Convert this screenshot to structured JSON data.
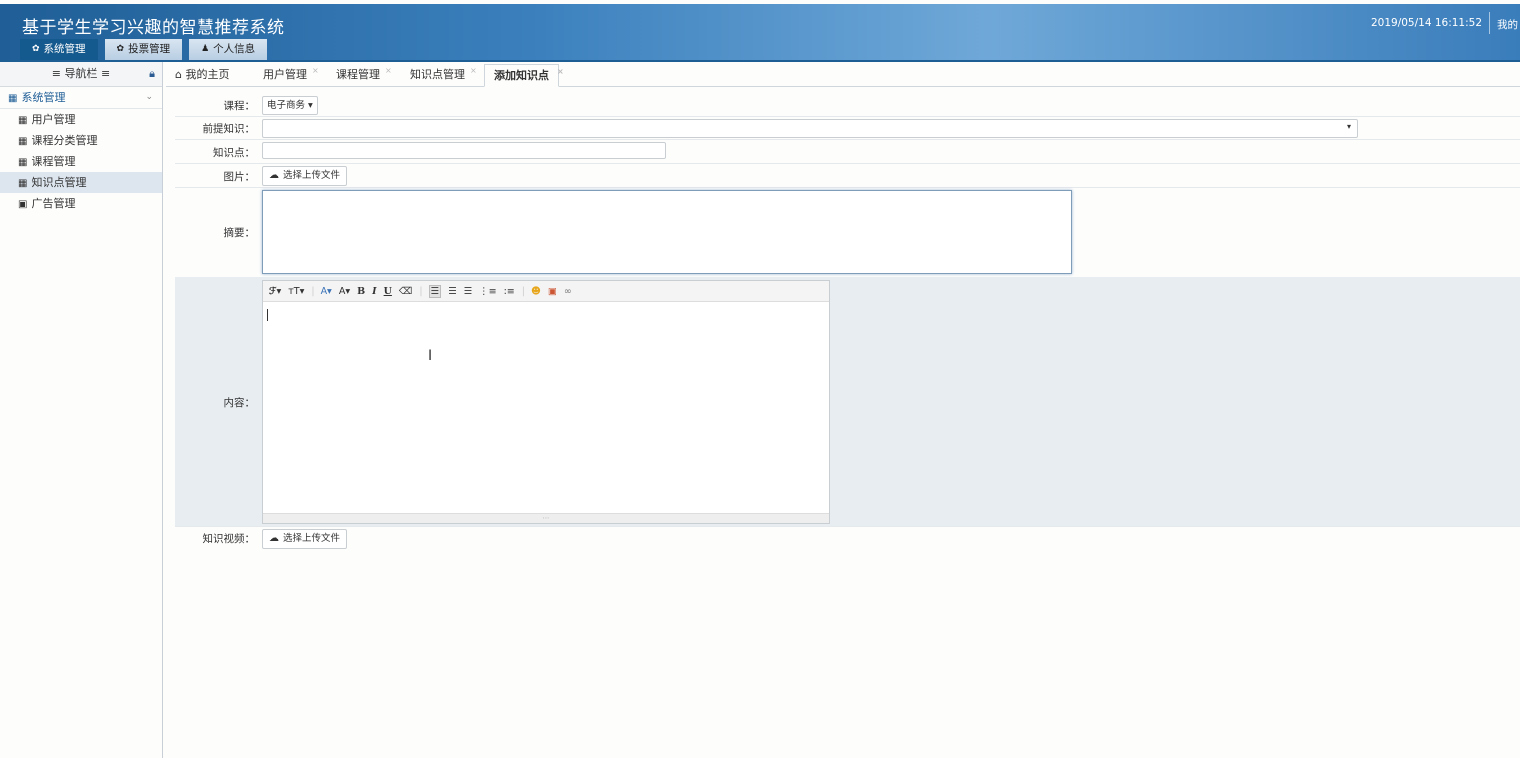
{
  "header": {
    "app_title": "基于学生学习兴趣的智慧推荐系统",
    "datetime": "2019/05/14 16:11:52",
    "user_link": "我的",
    "nav": [
      {
        "label": "系统管理",
        "icon": "gear-icon"
      },
      {
        "label": "投票管理",
        "icon": "gear-icon"
      },
      {
        "label": "个人信息",
        "icon": "user-icon"
      }
    ]
  },
  "sidebar": {
    "title": "≡ 导航栏 ≡",
    "group_label": "系统管理",
    "items": [
      {
        "label": "用户管理",
        "icon": "table-icon"
      },
      {
        "label": "课程分类管理",
        "icon": "table-icon"
      },
      {
        "label": "课程管理",
        "icon": "table-icon"
      },
      {
        "label": "知识点管理",
        "icon": "table-icon"
      },
      {
        "label": "广告管理",
        "icon": "picture-icon"
      }
    ]
  },
  "tabs": [
    {
      "label": "我的主页",
      "icon": "home-icon"
    },
    {
      "label": "用户管理"
    },
    {
      "label": "课程管理"
    },
    {
      "label": "知识点管理"
    },
    {
      "label": "添加知识点"
    }
  ],
  "form": {
    "course_label": "课程：",
    "course_value": "电子商务",
    "prereq_label": "前提知识：",
    "prereq_value": "",
    "kp_label": "知识点：",
    "kp_value": "",
    "image_label": "图片：",
    "upload_label": "选择上传文件",
    "summary_label": "摘要：",
    "content_label": "内容：",
    "video_label": "知识视频：",
    "video_upload_label": "选择上传文件"
  },
  "colors": {
    "header_start": "#1f5e96",
    "header_end": "#6fa8d8",
    "active_tab": "#155a8e",
    "content_row_bg": "#e8edf1"
  }
}
